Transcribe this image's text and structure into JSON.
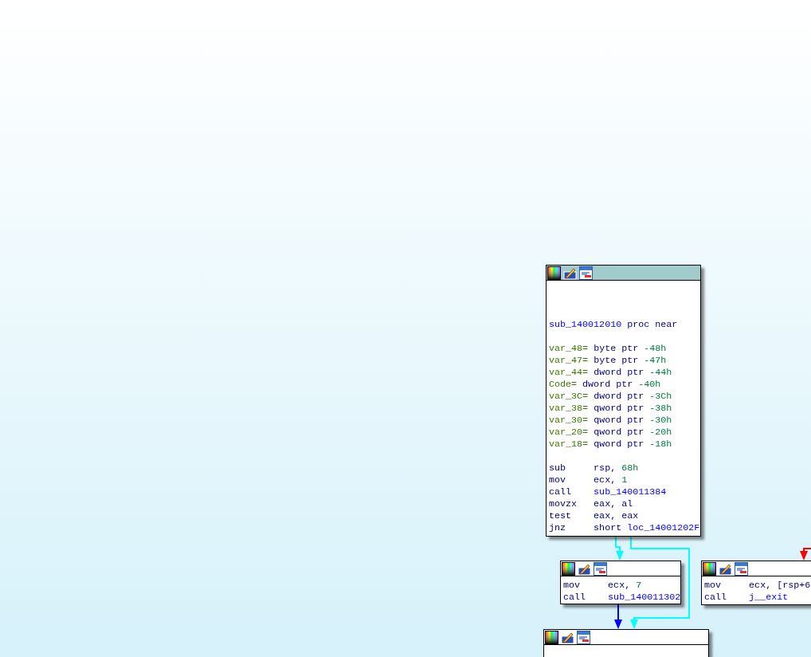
{
  "nodes": [
    {
      "kind": "function_start",
      "sections": [
        [
          {
            "tokens": [
              {
                "t": "sub_140012010",
                "kind": "name"
              },
              {
                "t": "proc near",
                "kind": "keyword"
              }
            ]
          }
        ],
        [
          {
            "tokens": [
              {
                "t": "var_48=",
                "kind": "var"
              },
              {
                "t": "byte ptr",
                "kind": "keyword"
              },
              {
                "t": "-48h",
                "kind": "number"
              }
            ]
          },
          {
            "tokens": [
              {
                "t": "var_47=",
                "kind": "var"
              },
              {
                "t": "byte ptr",
                "kind": "keyword"
              },
              {
                "t": "-47h",
                "kind": "number"
              }
            ]
          },
          {
            "tokens": [
              {
                "t": "var_44=",
                "kind": "var"
              },
              {
                "t": "dword ptr",
                "kind": "keyword"
              },
              {
                "t": "-44h",
                "kind": "number"
              }
            ]
          },
          {
            "tokens": [
              {
                "t": "Code=",
                "kind": "var"
              },
              {
                "t": "dword ptr",
                "kind": "keyword"
              },
              {
                "t": "-40h",
                "kind": "number"
              }
            ]
          },
          {
            "tokens": [
              {
                "t": "var_3C=",
                "kind": "var"
              },
              {
                "t": "dword ptr",
                "kind": "keyword"
              },
              {
                "t": "-3Ch",
                "kind": "number"
              }
            ]
          },
          {
            "tokens": [
              {
                "t": "var_38=",
                "kind": "var"
              },
              {
                "t": "qword ptr",
                "kind": "keyword"
              },
              {
                "t": "-38h",
                "kind": "number"
              }
            ]
          },
          {
            "tokens": [
              {
                "t": "var_30=",
                "kind": "var"
              },
              {
                "t": "qword ptr",
                "kind": "keyword"
              },
              {
                "t": "-30h",
                "kind": "number"
              }
            ]
          },
          {
            "tokens": [
              {
                "t": "var_20=",
                "kind": "var"
              },
              {
                "t": "qword ptr",
                "kind": "keyword"
              },
              {
                "t": "-20h",
                "kind": "number"
              }
            ]
          },
          {
            "tokens": [
              {
                "t": "var_18=",
                "kind": "var"
              },
              {
                "t": "qword ptr",
                "kind": "keyword"
              },
              {
                "t": "-18h",
                "kind": "number"
              }
            ]
          }
        ],
        [
          {
            "tokens": [
              {
                "t": "sub",
                "kind": "mnemonic"
              },
              {
                "t": "rsp,",
                "kind": "keyword"
              },
              {
                "t": "68h",
                "kind": "number"
              }
            ]
          },
          {
            "tokens": [
              {
                "t": "mov",
                "kind": "mnemonic"
              },
              {
                "t": "ecx,",
                "kind": "keyword"
              },
              {
                "t": "1",
                "kind": "number"
              }
            ]
          },
          {
            "tokens": [
              {
                "t": "call",
                "kind": "mnemonic"
              },
              {
                "t": "sub_140011384",
                "kind": "name"
              }
            ]
          },
          {
            "tokens": [
              {
                "t": "movzx",
                "kind": "mnemonic"
              },
              {
                "t": "eax, al",
                "kind": "keyword"
              }
            ]
          },
          {
            "tokens": [
              {
                "t": "test",
                "kind": "mnemonic"
              },
              {
                "t": "eax, eax",
                "kind": "keyword"
              }
            ]
          },
          {
            "tokens": [
              {
                "t": "jnz",
                "kind": "mnemonic"
              },
              {
                "t": "short",
                "kind": "keyword"
              },
              {
                "t": "loc_14001202F",
                "kind": "name"
              }
            ]
          }
        ]
      ]
    },
    {
      "kind": "block",
      "sections": [
        [
          {
            "tokens": [
              {
                "t": "mov",
                "kind": "mnemonic"
              },
              {
                "t": "ecx,",
                "kind": "keyword"
              },
              {
                "t": "7",
                "kind": "number"
              }
            ]
          },
          {
            "tokens": [
              {
                "t": "call",
                "kind": "mnemonic"
              },
              {
                "t": "sub_140011302",
                "kind": "name"
              }
            ]
          }
        ]
      ]
    },
    {
      "kind": "block",
      "sections": [
        [
          {
            "tokens": [
              {
                "t": "mov",
                "kind": "mnemonic"
              },
              {
                "t": "ecx, [rsp+6",
                "kind": "keyword"
              }
            ]
          },
          {
            "tokens": [
              {
                "t": "call",
                "kind": "mnemonic"
              },
              {
                "t": "j__exit",
                "kind": "name"
              }
            ]
          }
        ]
      ]
    },
    {
      "kind": "block"
    }
  ],
  "edges": [
    {
      "color": "#00ffff"
    },
    {
      "color": "#00ffff"
    },
    {
      "color": "#0000ff"
    },
    {
      "color": "#ff0000"
    }
  ]
}
